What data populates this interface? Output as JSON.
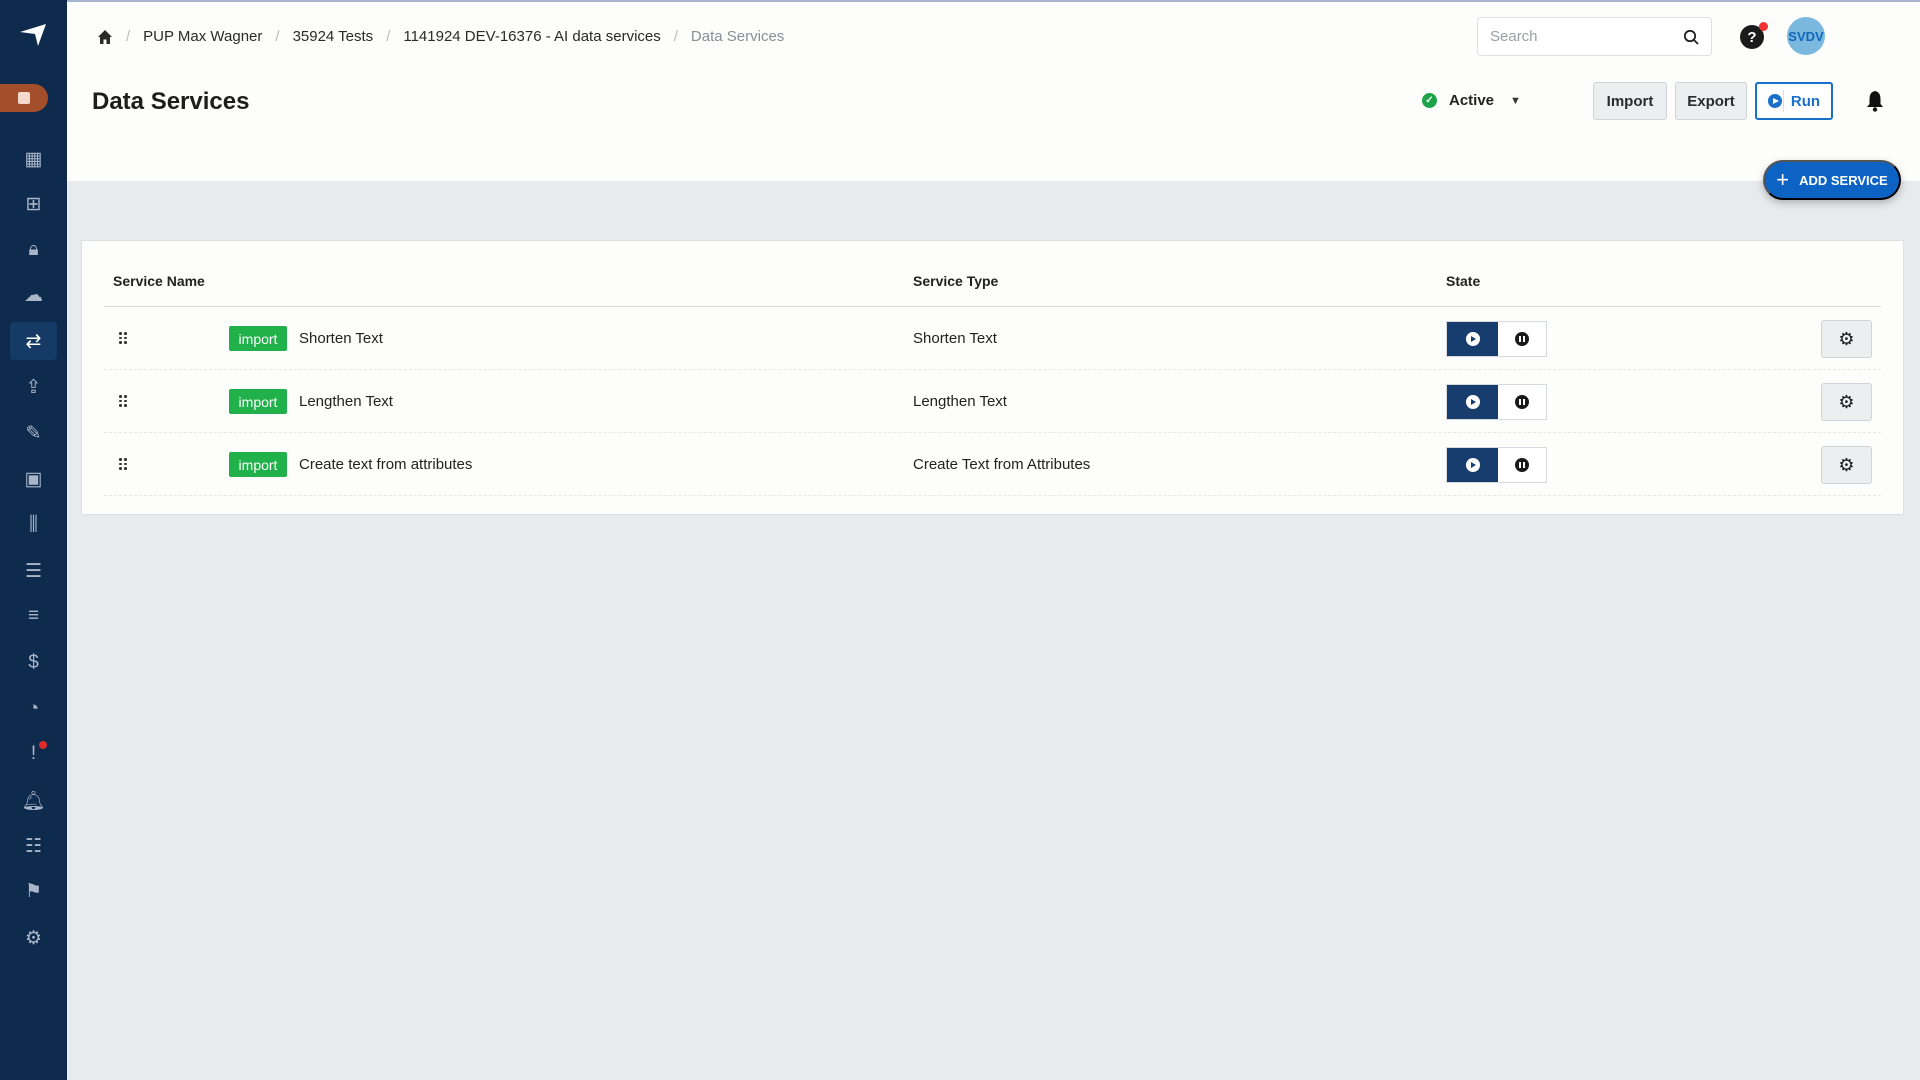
{
  "breadcrumb": [
    "PUP Max Wagner",
    "35924 Tests",
    "1141924 DEV-16376 - AI data services",
    "Data Services"
  ],
  "page_title": "Data Services",
  "search": {
    "placeholder": "Search"
  },
  "user": {
    "initials": "SVDV"
  },
  "status": {
    "label": "Active"
  },
  "toolbar": {
    "import_label": "Import",
    "export_label": "Export",
    "run_label": "Run"
  },
  "add_service_label": "ADD SERVICE",
  "table": {
    "headers": {
      "name": "Service Name",
      "type": "Service Type",
      "state": "State"
    },
    "rows": [
      {
        "badge": "import",
        "name": "Shorten Text",
        "type": "Shorten Text",
        "state": "running"
      },
      {
        "badge": "import",
        "name": "Lengthen Text",
        "type": "Lengthen Text",
        "state": "running"
      },
      {
        "badge": "import",
        "name": "Create text from attributes",
        "type": "Create Text from Attributes",
        "state": "running"
      }
    ]
  },
  "sidebar": {
    "icons": [
      "dashboard-icon",
      "hierarchy-icon",
      "lock-icon",
      "download-cloud-icon",
      "data-services-icon",
      "upload-icon",
      "brush-icon",
      "schedule-icon",
      "columns-icon",
      "list-split-icon",
      "list-icon",
      "dollar-icon",
      "pie-chart-icon",
      "alert-icon",
      "bell-icon",
      "checklist-icon",
      "flag-icon",
      "settings-icon"
    ]
  },
  "colors": {
    "sidebar": "#0e2a4d",
    "accent": "#0d63c4",
    "badge": "#20b14a",
    "toggle_active": "#173c6e"
  }
}
